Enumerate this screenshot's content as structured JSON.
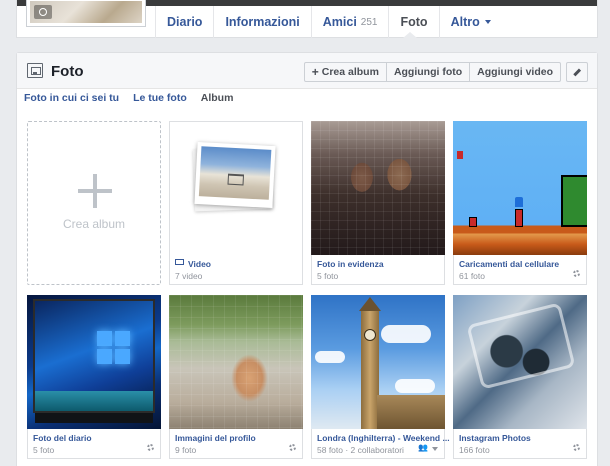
{
  "profile_nav": {
    "tabs": [
      {
        "label": "Diario"
      },
      {
        "label": "Informazioni"
      },
      {
        "label": "Amici",
        "count": "251"
      },
      {
        "label": "Foto"
      },
      {
        "label": "Altro"
      }
    ],
    "active_tab": "Foto"
  },
  "photos_section": {
    "title": "Foto",
    "buttons": {
      "create_album": "Crea album",
      "add_photos": "Aggiungi foto",
      "add_video": "Aggiungi video"
    },
    "subtabs": [
      "Foto in cui ci sei tu",
      "Le tue foto",
      "Album"
    ],
    "active_subtab": "Album",
    "create_album_tile_label": "Crea album"
  },
  "albums": [
    {
      "name": "Video",
      "count": "7 video"
    },
    {
      "name": "Foto in evidenza",
      "count": "5 foto"
    },
    {
      "name": "Caricamenti dal cellulare",
      "count": "61 foto"
    },
    {
      "name": "Foto del diario",
      "count": "5 foto"
    },
    {
      "name": "Immagini del profilo",
      "count": "9 foto"
    },
    {
      "name": "Londra (Inghilterra) - Weekend ...",
      "count": "58 foto · 2 collaboratori"
    },
    {
      "name": "Instagram Photos",
      "count": "166 foto"
    }
  ],
  "colors": {
    "link": "#365899",
    "page_bg": "#e9ebee",
    "muted": "#90949c"
  }
}
